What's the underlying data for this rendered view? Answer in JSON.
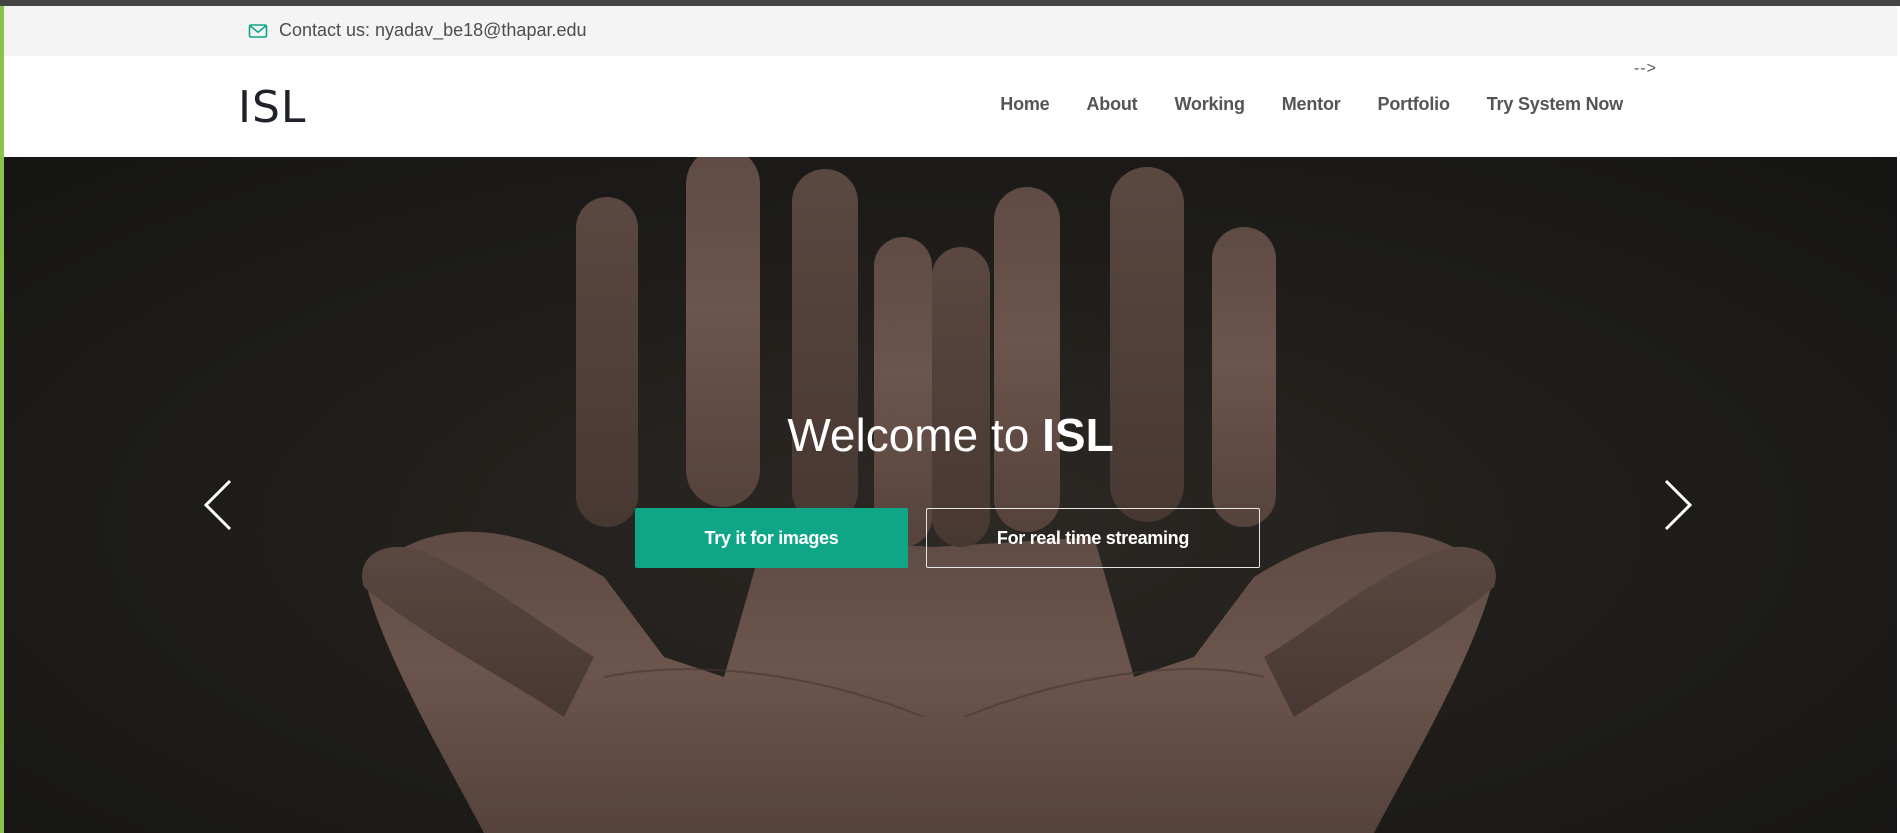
{
  "topbar": {
    "contact_icon": "envelope-icon",
    "contact_text": "Contact us: nyadav_be18@thapar.edu"
  },
  "header": {
    "logo_text": "ISL",
    "stray_text": "-->",
    "nav": [
      {
        "label": "Home"
      },
      {
        "label": "About"
      },
      {
        "label": "Working"
      },
      {
        "label": "Mentor"
      },
      {
        "label": "Portfolio"
      },
      {
        "label": "Try System Now"
      }
    ]
  },
  "hero": {
    "title_prefix": "Welcome to ",
    "title_bold": "ISL",
    "primary_button": "Try it for images",
    "secondary_button": "For real time streaming",
    "prev_icon": "chevron-left-icon",
    "next_icon": "chevron-right-icon"
  },
  "colors": {
    "accent": "#0fa688",
    "left_accent": "#8bc34a",
    "nav_text": "#555555",
    "topbar_bg": "#f4f4f4"
  }
}
